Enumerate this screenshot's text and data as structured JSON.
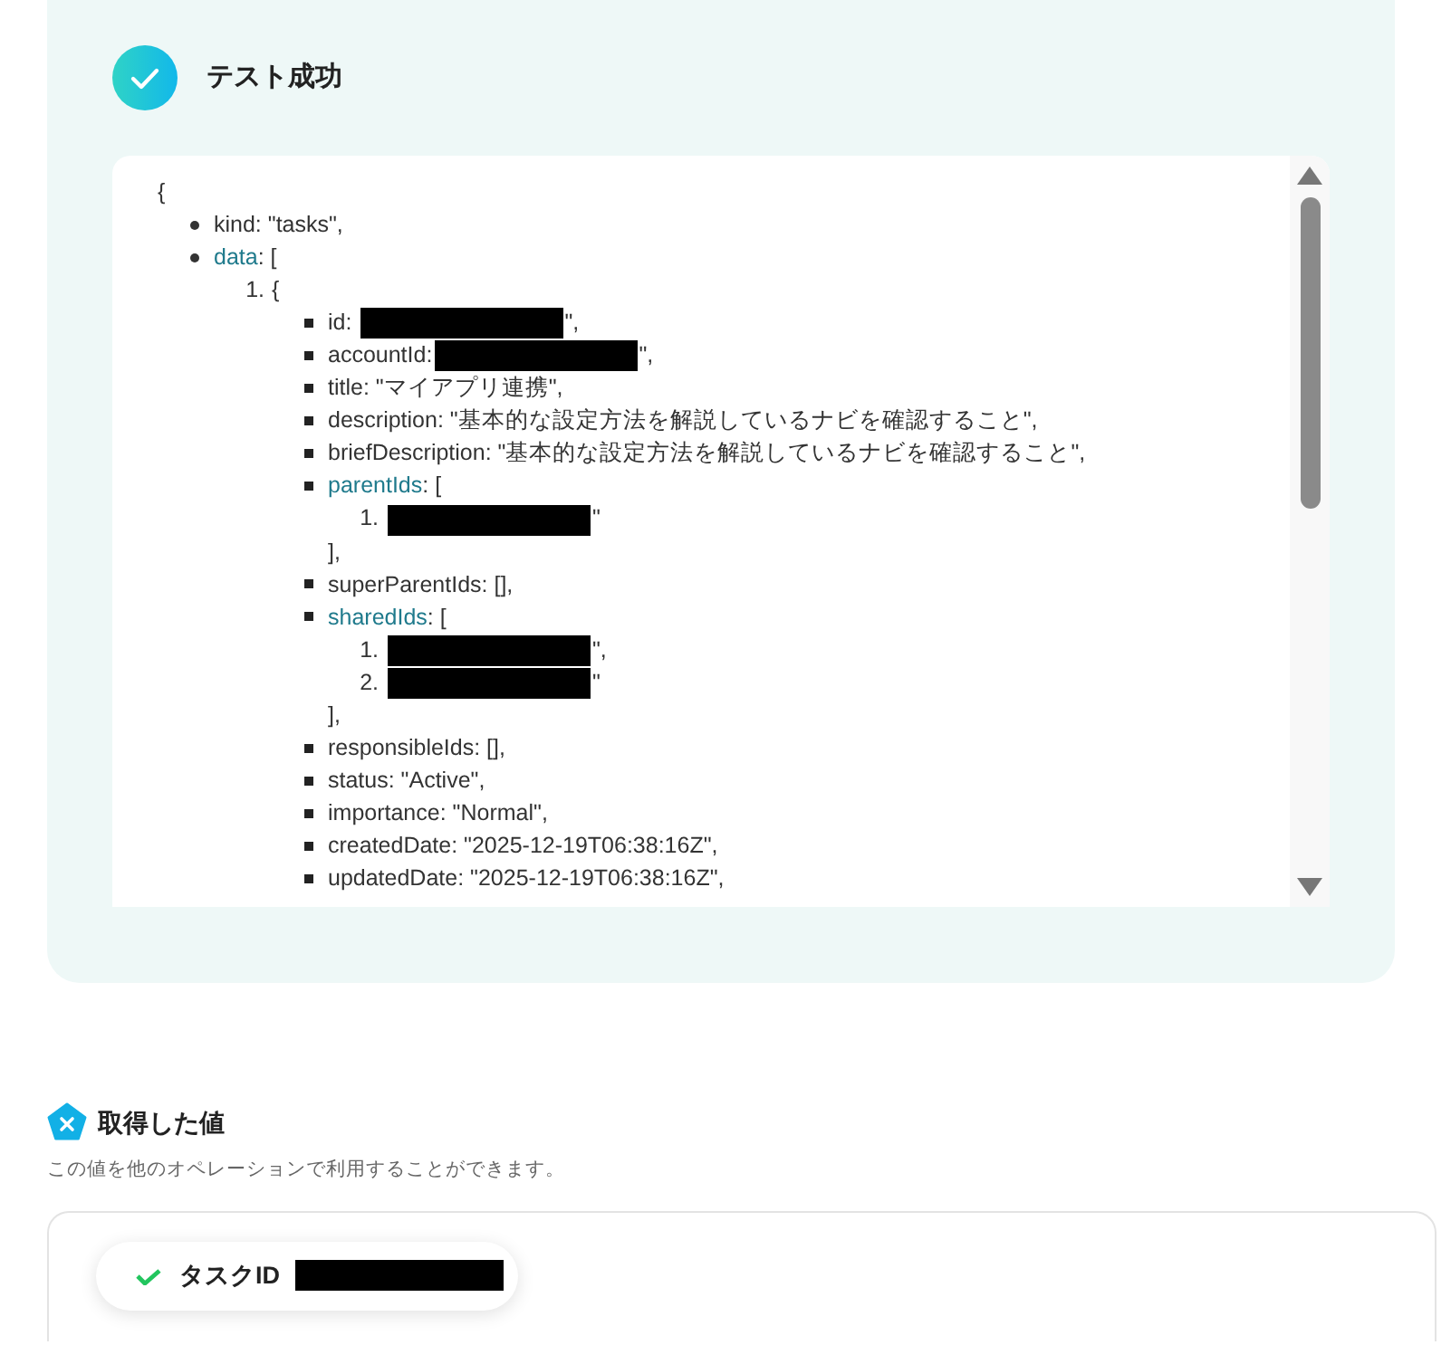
{
  "result_panel": {
    "title": "テスト成功",
    "json_viewer": {
      "text": "{",
      "children": [
        {
          "kind": "disc",
          "key": "kind",
          "text": ": \"tasks\","
        },
        {
          "kind": "disc",
          "key": "data",
          "link": true,
          "text": ": [",
          "children": [
            {
              "kind": "number",
              "marker": "1.",
              "text": "{",
              "children": [
                {
                  "kind": "square",
                  "key": "id",
                  "text": ": ",
                  "redacted": true,
                  "tail": "\","
                },
                {
                  "kind": "square",
                  "key": "accountId",
                  "text": ":",
                  "redacted": true,
                  "tail": "\","
                },
                {
                  "kind": "square",
                  "key": "title",
                  "text": ": \"マイアプリ連携\","
                },
                {
                  "kind": "square",
                  "key": "description",
                  "text": ": \"基本的な設定方法を解説しているナビを確認すること\","
                },
                {
                  "kind": "square",
                  "key": "briefDescription",
                  "text": ": \"基本的な設定方法を解説しているナビを確認すること\","
                },
                {
                  "kind": "square",
                  "key": "parentIds",
                  "link": true,
                  "text": ": [",
                  "close": "],",
                  "children": [
                    {
                      "kind": "number",
                      "marker": "1.",
                      "redacted": true,
                      "tail": "\""
                    }
                  ]
                },
                {
                  "kind": "square",
                  "key": "superParentIds",
                  "text": ": [],"
                },
                {
                  "kind": "square",
                  "key": "sharedIds",
                  "link": true,
                  "text": ": [",
                  "close": "],",
                  "children": [
                    {
                      "kind": "number",
                      "marker": "1.",
                      "redacted": true,
                      "tail": "\","
                    },
                    {
                      "kind": "number",
                      "marker": "2.",
                      "redacted": true,
                      "tail": "\""
                    }
                  ]
                },
                {
                  "kind": "square",
                  "key": "responsibleIds",
                  "text": ": [],"
                },
                {
                  "kind": "square",
                  "key": "status",
                  "text": ": \"Active\","
                },
                {
                  "kind": "square",
                  "key": "importance",
                  "text": ": \"Normal\","
                },
                {
                  "kind": "square",
                  "key": "createdDate",
                  "text": ": \"2025-12-19T06:38:16Z\","
                },
                {
                  "kind": "square",
                  "key": "updatedDate",
                  "text": ": \"2025-12-19T06:38:16Z\","
                }
              ]
            }
          ]
        }
      ]
    }
  },
  "values_section": {
    "title": "取得した値",
    "description": "この値を他のオペレーションで利用することができます。",
    "values": [
      {
        "label": "タスクID",
        "redacted": true
      }
    ]
  }
}
